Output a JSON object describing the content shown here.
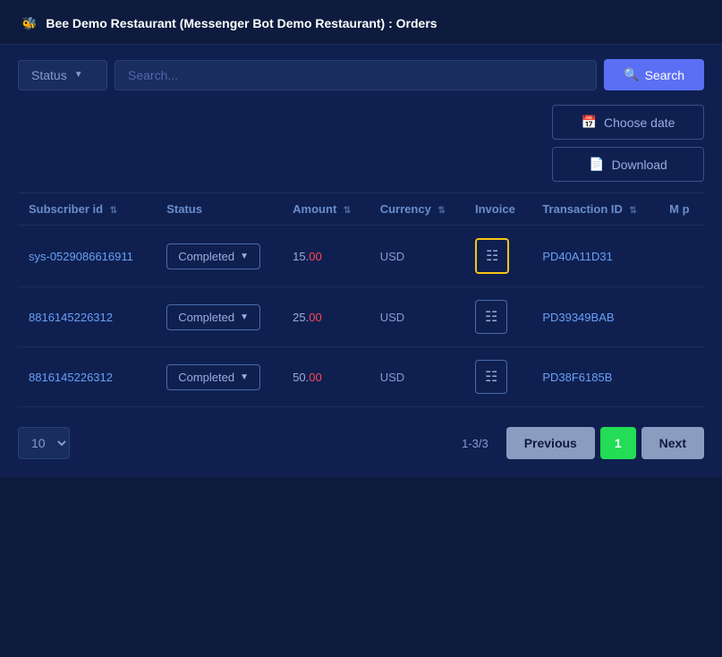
{
  "header": {
    "icon": "🐝",
    "title": "Bee Demo Restaurant (Messenger Bot Demo Restaurant) : Orders"
  },
  "toolbar": {
    "status_label": "Status",
    "search_placeholder": "Search...",
    "search_btn_label": "Search"
  },
  "actions": {
    "choose_date_label": "Choose date",
    "download_label": "Download"
  },
  "table": {
    "columns": [
      {
        "key": "subscriber_id",
        "label": "Subscriber id"
      },
      {
        "key": "status",
        "label": "Status"
      },
      {
        "key": "amount",
        "label": "Amount"
      },
      {
        "key": "currency",
        "label": "Currency"
      },
      {
        "key": "invoice",
        "label": "Invoice"
      },
      {
        "key": "transaction_id",
        "label": "Transaction ID"
      },
      {
        "key": "more",
        "label": "M p"
      }
    ],
    "rows": [
      {
        "subscriber_id": "sys-0529086616911",
        "status": "Completed",
        "amount": "15.00",
        "amount_dot": "0",
        "currency": "USD",
        "invoice_highlighted": true,
        "transaction_id": "PD40A11D31"
      },
      {
        "subscriber_id": "8816145226312",
        "status": "Completed",
        "amount": "25.00",
        "amount_dot": "0",
        "currency": "USD",
        "invoice_highlighted": false,
        "transaction_id": "PD39349BAB"
      },
      {
        "subscriber_id": "8816145226312",
        "status": "Completed",
        "amount": "50.00",
        "amount_dot": "0",
        "currency": "USD",
        "invoice_highlighted": false,
        "transaction_id": "PD38F6185B"
      }
    ]
  },
  "pagination": {
    "per_page": "10",
    "range_label": "1-3/3",
    "prev_label": "Previous",
    "page_num": "1",
    "next_label": "Next"
  }
}
